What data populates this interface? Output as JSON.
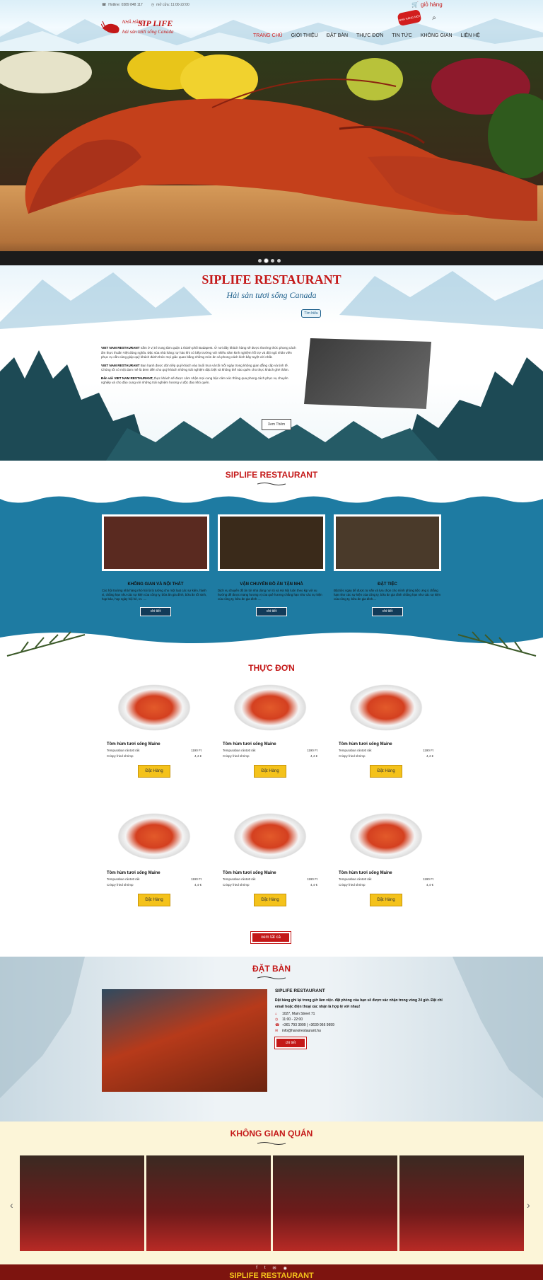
{
  "header": {
    "hotline": "Hotline: 0389 848 117",
    "hours": "mở cửa: 11:00-22:00",
    "cart_label": "giỏ hàng",
    "badge": "NHÀ HÀNG MỚI",
    "logo_top": "NHÀ HÀNG",
    "logo_brand": "SIP LIFE",
    "logo_slogan": "hải sản tươi sống Canada",
    "search_icon": "search-icon"
  },
  "nav": {
    "items": [
      "TRANG CHỦ",
      "GIỚI THIỆU",
      "ĐẶT BÀN",
      "THỰC ĐƠN",
      "TIN TỨC",
      "KHÔNG GIAN",
      "LIÊN HỆ"
    ]
  },
  "about": {
    "title": "SIPLIFE RESTAURANT",
    "subtitle": "Hải sản tươi sống Canada",
    "tag": "Tìm hiểu",
    "p1_lead": "VIET NAM RESTAURANT",
    "p1": " nằm ở vị trí trung tâm quận 1 thành phố Budapest. Ở nơi đây khách hàng sẽ được thưởng thức phong cách ẩm thực thuần Việt đúng nghĩa. Đặc sủa nhà hàng: tự hào khi có bếp trưởng với nhiều năm kinh nghiệm hỗ trợ và đội ngũ nhân viên phục vụ cần cảng giúp quý khách đánh thức mọi giác quan bằng những món ăn và phong cách kinh bảy tuyệt vời nhất.",
    "p2_lead": "VIET NAM RESTAURANT",
    "p2": " Ban hạnh được đón tiếp quý khách vào buổi trưa và tối mỗi ngày trong không gian đẳng cấp và tinh tế. Chúng tôi có một dam mê là đem đến cho quý khách những trải nghiệm đặc biệt và không thể nào quên cho thực khách ghé thăm.",
    "p3_lead": "Đến với VIET NAM RESTAURANT,",
    "p3": " thực khách sẽ được cảm nhận mọi cung bậc cảm xúc thông qua phong cách phục vụ chuyên nghiệp và cho đáo cung với những trải nghiệm hương vị độc đáo khó quên.",
    "more": "Xem Thêm"
  },
  "services": {
    "title": "SIPLIFE RESTAURANT",
    "cards": [
      {
        "name": "KHÔNG GIAN VÀ NỘI THẤT",
        "desc": "Các hội trường nhà hàng nhỏ hội là lý tưởng cho một loạt các sự kiện, hành vi, chẳng hạn như các sự kiện của công ty, bữa ăn gia đình, bữa ăn tối sinh, họp báo, họp ngày hội hè, vv. ....",
        "btn": "chi tiết"
      },
      {
        "name": "VẬN CHUYỂN ĐỒ ĂN TẬN NHÀ",
        "desc": "Dịch vụ chuyển đồ ăn tới nhà dùng nơi rộ và Hà Nội luôn theo kịp với xu hướng để được mang hương vị của quê hương chẳng hạn như các sự kiện của công ty, bữa ăn gia đình ....",
        "btn": "chi tiết"
      },
      {
        "name": "ĐẶT TIỆC",
        "desc": "Đặt tiệc ngay để được tư vấn và lựa chọn cho mình phòng tiệc ưng ý chẳng hạn như các sự kiện của công ty, bữa ăn gia đình chẳng hạn như các sự kiện của công ty, bữa ăn gia đình....",
        "btn": "chi tiết"
      }
    ]
  },
  "menu": {
    "title": "THỰC ĐƠN",
    "dishes": [
      {
        "name": "Tôm hùm tươi sống Maine",
        "item1": "Tempuraban rántott rák",
        "price1": "1190 Ft",
        "item2": "Crispy fried shrimp",
        "price2": "4,4 €",
        "btn": "Đặt Hàng"
      },
      {
        "name": "Tôm hùm tươi sống Maine",
        "item1": "Tempuraban rántott rák",
        "price1": "1190 Ft",
        "item2": "Crispy fried shrimp",
        "price2": "4,4 €",
        "btn": "Đặt Hàng"
      },
      {
        "name": "Tôm hùm tươi sống Maine",
        "item1": "Tempuraban rántott rák",
        "price1": "1190 Ft",
        "item2": "Crispy fried shrimp",
        "price2": "4,4 €",
        "btn": "Đặt Hàng"
      },
      {
        "name": "Tôm hùm tươi sống Maine",
        "item1": "Tempuraban rántott rák",
        "price1": "1190 Ft",
        "item2": "Crispy fried shrimp",
        "price2": "4,4 €",
        "btn": "Đặt Hàng"
      },
      {
        "name": "Tôm hùm tươi sống Maine",
        "item1": "Tempuraban rántott rák",
        "price1": "1190 Ft",
        "item2": "Crispy fried shrimp",
        "price2": "4,4 €",
        "btn": "Đặt Hàng"
      },
      {
        "name": "Tôm hùm tươi sống Maine",
        "item1": "Tempuraban rántott rák",
        "price1": "1190 Ft",
        "item2": "Crispy fried shrimp",
        "price2": "4,4 €",
        "btn": "Đặt Hàng"
      }
    ],
    "all_btn": "xem tất cả"
  },
  "booking": {
    "title": "ĐẶT BÀN",
    "name": "SIPLIFE RESTAURANT",
    "desc": "Đặt bàng ghi lại trong giờ làm việc. đặt phòng của bạn sẽ được xác nhận trong vòng 24 giờ. Đặt chỉ email hoặc điện thoại xác nhận là hợp lệ với nhau!",
    "address": "1027, Main Street 71",
    "hours": "11:00 - 22:00",
    "phone": "+361 793 3999 | +3630 966 9999",
    "email": "info@hanoirestaurant.hu",
    "btn": "chi tiết"
  },
  "space": {
    "title": "KHÔNG GIAN QUÁN"
  },
  "footer": {
    "title": "SIPLIFE RESTAURANT"
  },
  "colors": {
    "accent": "#c41818",
    "teal": "#1e7ba2",
    "gold": "#f4c21b"
  }
}
